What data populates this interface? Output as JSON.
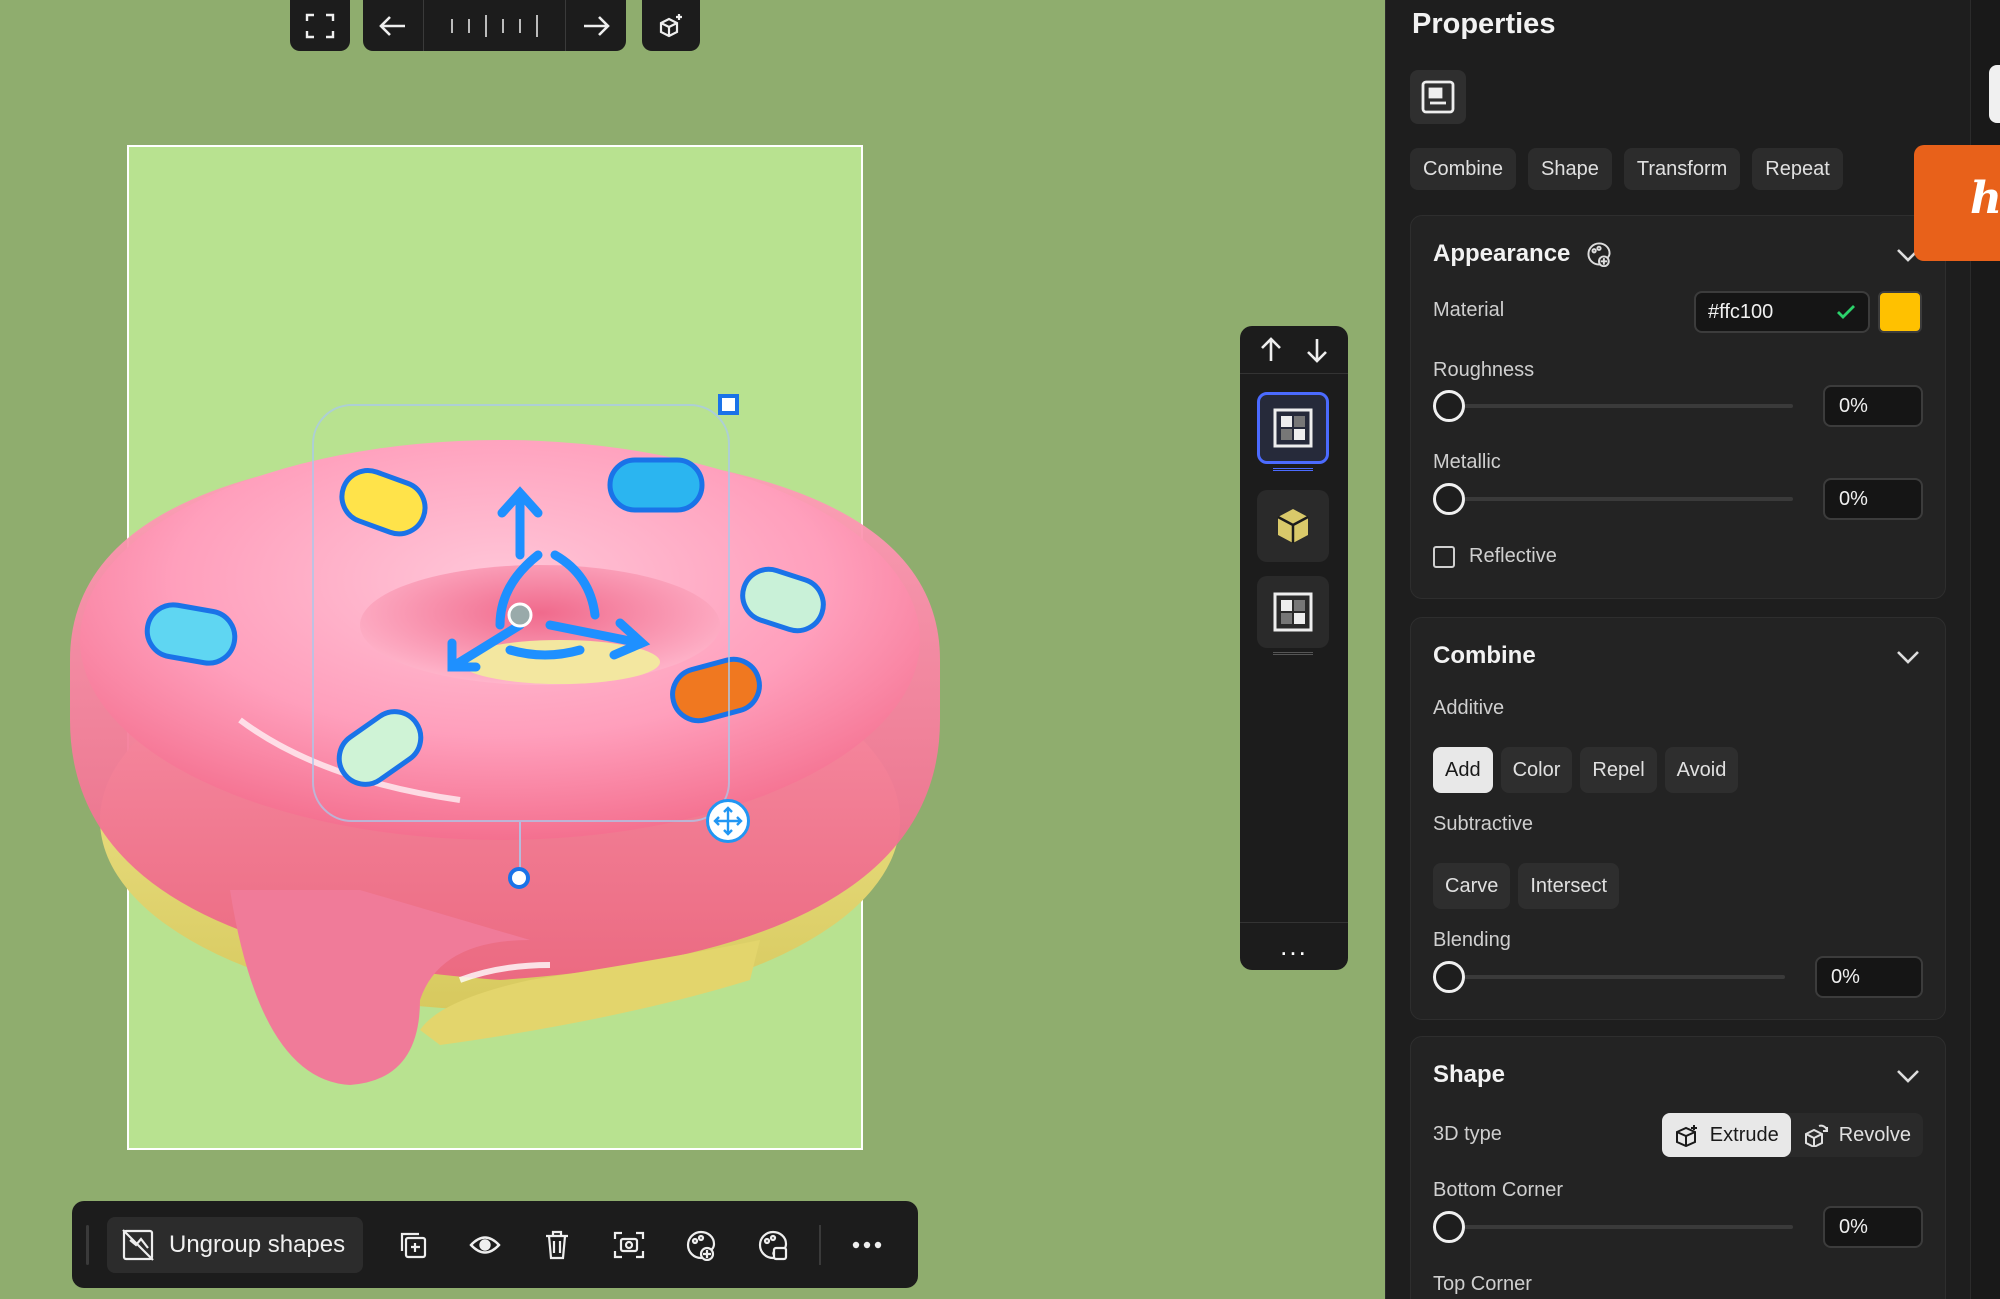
{
  "colors": {
    "canvas_bg": "#8fad6e",
    "artboard_bg": "#b8e290",
    "panel_bg": "#1e1e1e",
    "accent": "#1a73e8",
    "material_swatch": "#ffc100",
    "orange_tab": "#e8611a"
  },
  "top_toolbar": {
    "icons": [
      "fit-screen-icon",
      "undo-arrow-icon",
      "timeline-ticks",
      "redo-arrow-icon",
      "ai-generate-icon"
    ]
  },
  "context_toolbar": {
    "ungroup_label": "Ungroup shapes",
    "icons": [
      "duplicate-icon",
      "visibility-icon",
      "delete-icon",
      "capture-icon",
      "appearance-add-icon",
      "appearance-apply-icon",
      "more-icon"
    ]
  },
  "layer_panel": {
    "more_label": "..."
  },
  "properties": {
    "title": "Properties",
    "tabs": [
      "Combine",
      "Shape",
      "Transform",
      "Repeat"
    ],
    "appearance": {
      "title": "Appearance",
      "material_label": "Material",
      "material_value": "#ffc100",
      "material_display": "#ffc100",
      "roughness_label": "Roughness",
      "roughness_value": "0%",
      "metallic_label": "Metallic",
      "metallic_value": "0%",
      "reflective_label": "Reflective",
      "reflective_checked": false
    },
    "combine": {
      "title": "Combine",
      "additive_label": "Additive",
      "additive_options": [
        "Add",
        "Color",
        "Repel",
        "Avoid"
      ],
      "additive_selected": "Add",
      "subtractive_label": "Subtractive",
      "subtractive_options": [
        "Carve",
        "Intersect"
      ],
      "blending_label": "Blending",
      "blending_value": "0%"
    },
    "shape": {
      "title": "Shape",
      "type_label": "3D type",
      "type_options": [
        "Extrude",
        "Revolve"
      ],
      "type_selected": "Extrude",
      "bottom_corner_label": "Bottom Corner",
      "bottom_corner_value": "0%",
      "top_corner_label": "Top Corner"
    }
  },
  "side_tab": {
    "glyph": "h"
  }
}
